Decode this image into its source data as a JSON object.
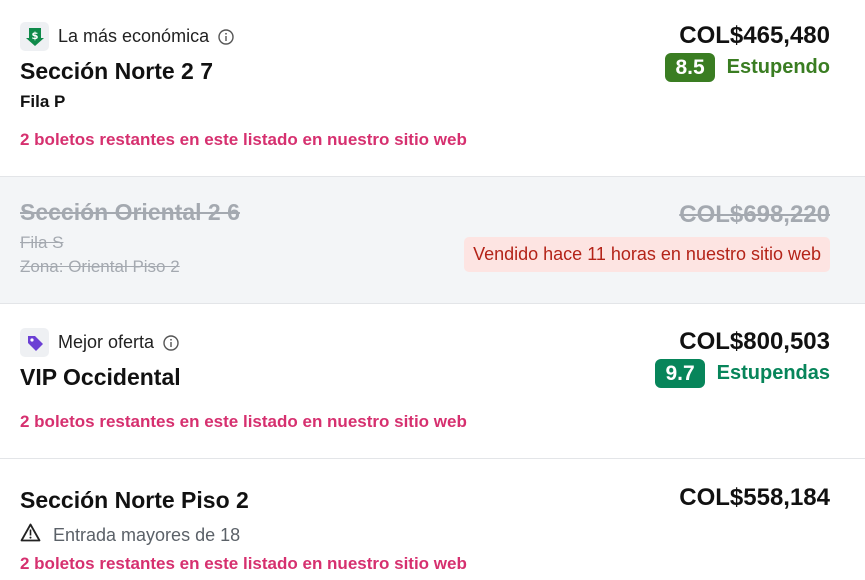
{
  "listings": [
    {
      "tag": {
        "label": "La más económica",
        "icon": "dollar-down-icon"
      },
      "section": "Sección Norte 2 7",
      "row": "Fila P",
      "price": "COL$465,480",
      "rating": {
        "score": "8.5",
        "label": "Estupendo",
        "color": "#3a7d22"
      },
      "availability": "2 boletos restantes en este listado en nuestro sitio web"
    },
    {
      "section": "Sección Oriental 2 6",
      "row": "Fila S",
      "zone": "Zona: Oriental Piso 2",
      "price": "COL$698,220",
      "sold_notice": "Vendido hace 11 horas en nuestro sitio web"
    },
    {
      "tag": {
        "label": "Mejor oferta",
        "icon": "price-tag-icon"
      },
      "section": "VIP Occidental",
      "price": "COL$800,503",
      "rating": {
        "score": "9.7",
        "label": "Estupendas",
        "color": "#07855a"
      },
      "availability": "2 boletos restantes en este listado en nuestro sitio web"
    },
    {
      "section": "Sección Norte Piso 2",
      "price": "COL$558,184",
      "warning": "Entrada mayores de 18",
      "availability": "2 boletos restantes en este listado en nuestro sitio web"
    }
  ],
  "colors": {
    "availability": "#d6306f",
    "sold_bg": "#fde4e2",
    "sold_text": "#b42318"
  }
}
